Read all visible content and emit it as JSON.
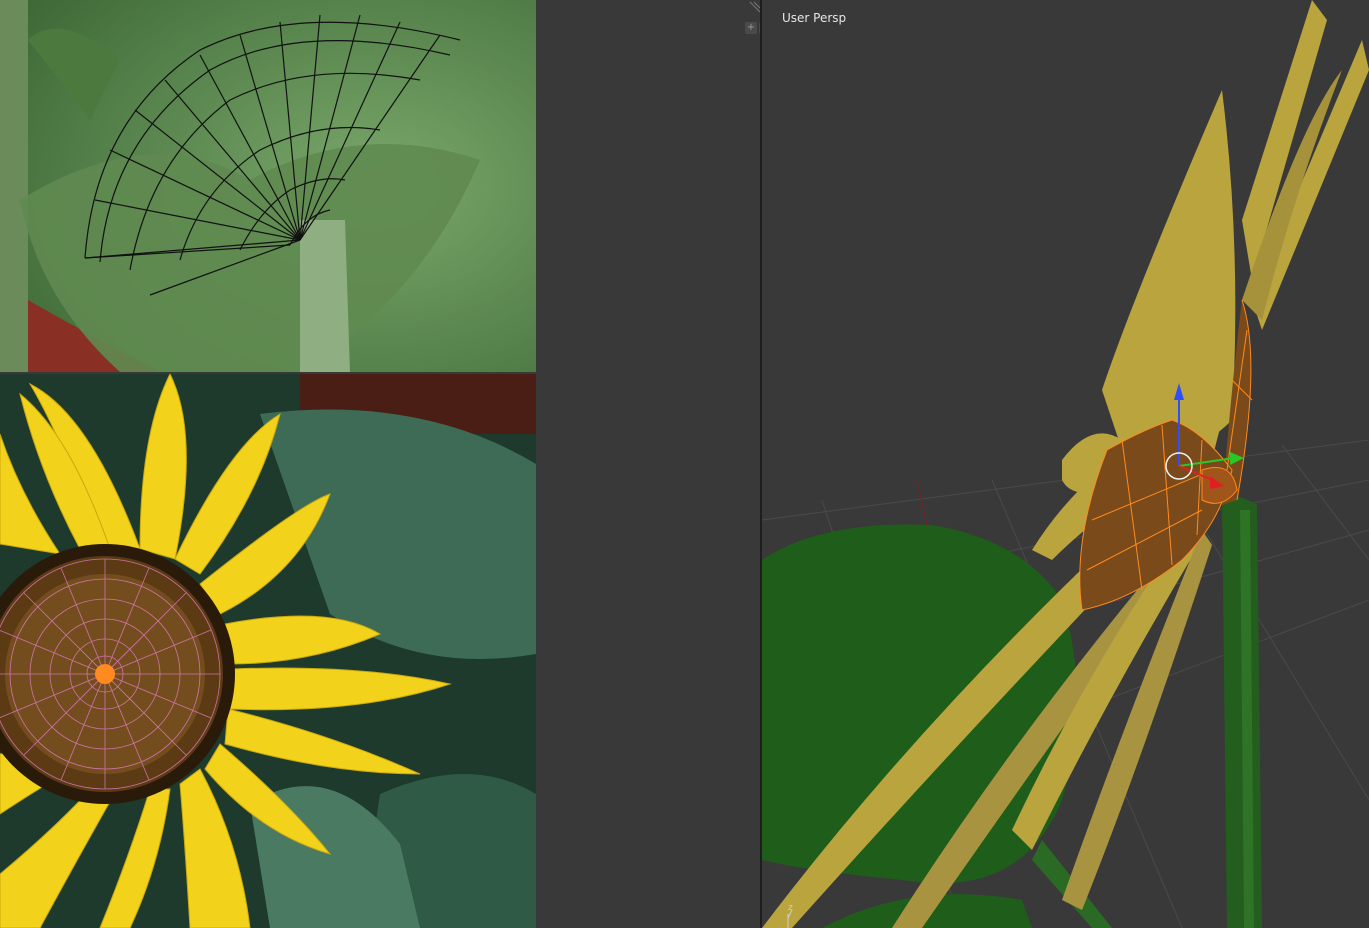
{
  "viewport": {
    "label": "User Persp",
    "axis_z_label": "z"
  },
  "image_editor": {
    "top_reference": "sunflower-bud-reference",
    "bottom_reference": "sunflower-bloom-reference"
  },
  "colors": {
    "background": "#393939",
    "mesh_yellow": "#b9a43e",
    "mesh_green": "#1f5d1a",
    "selection_orange": "#ff8a1f",
    "gizmo_z": "#2f4fff",
    "gizmo_y": "#28c828",
    "gizmo_x": "#e02020"
  }
}
